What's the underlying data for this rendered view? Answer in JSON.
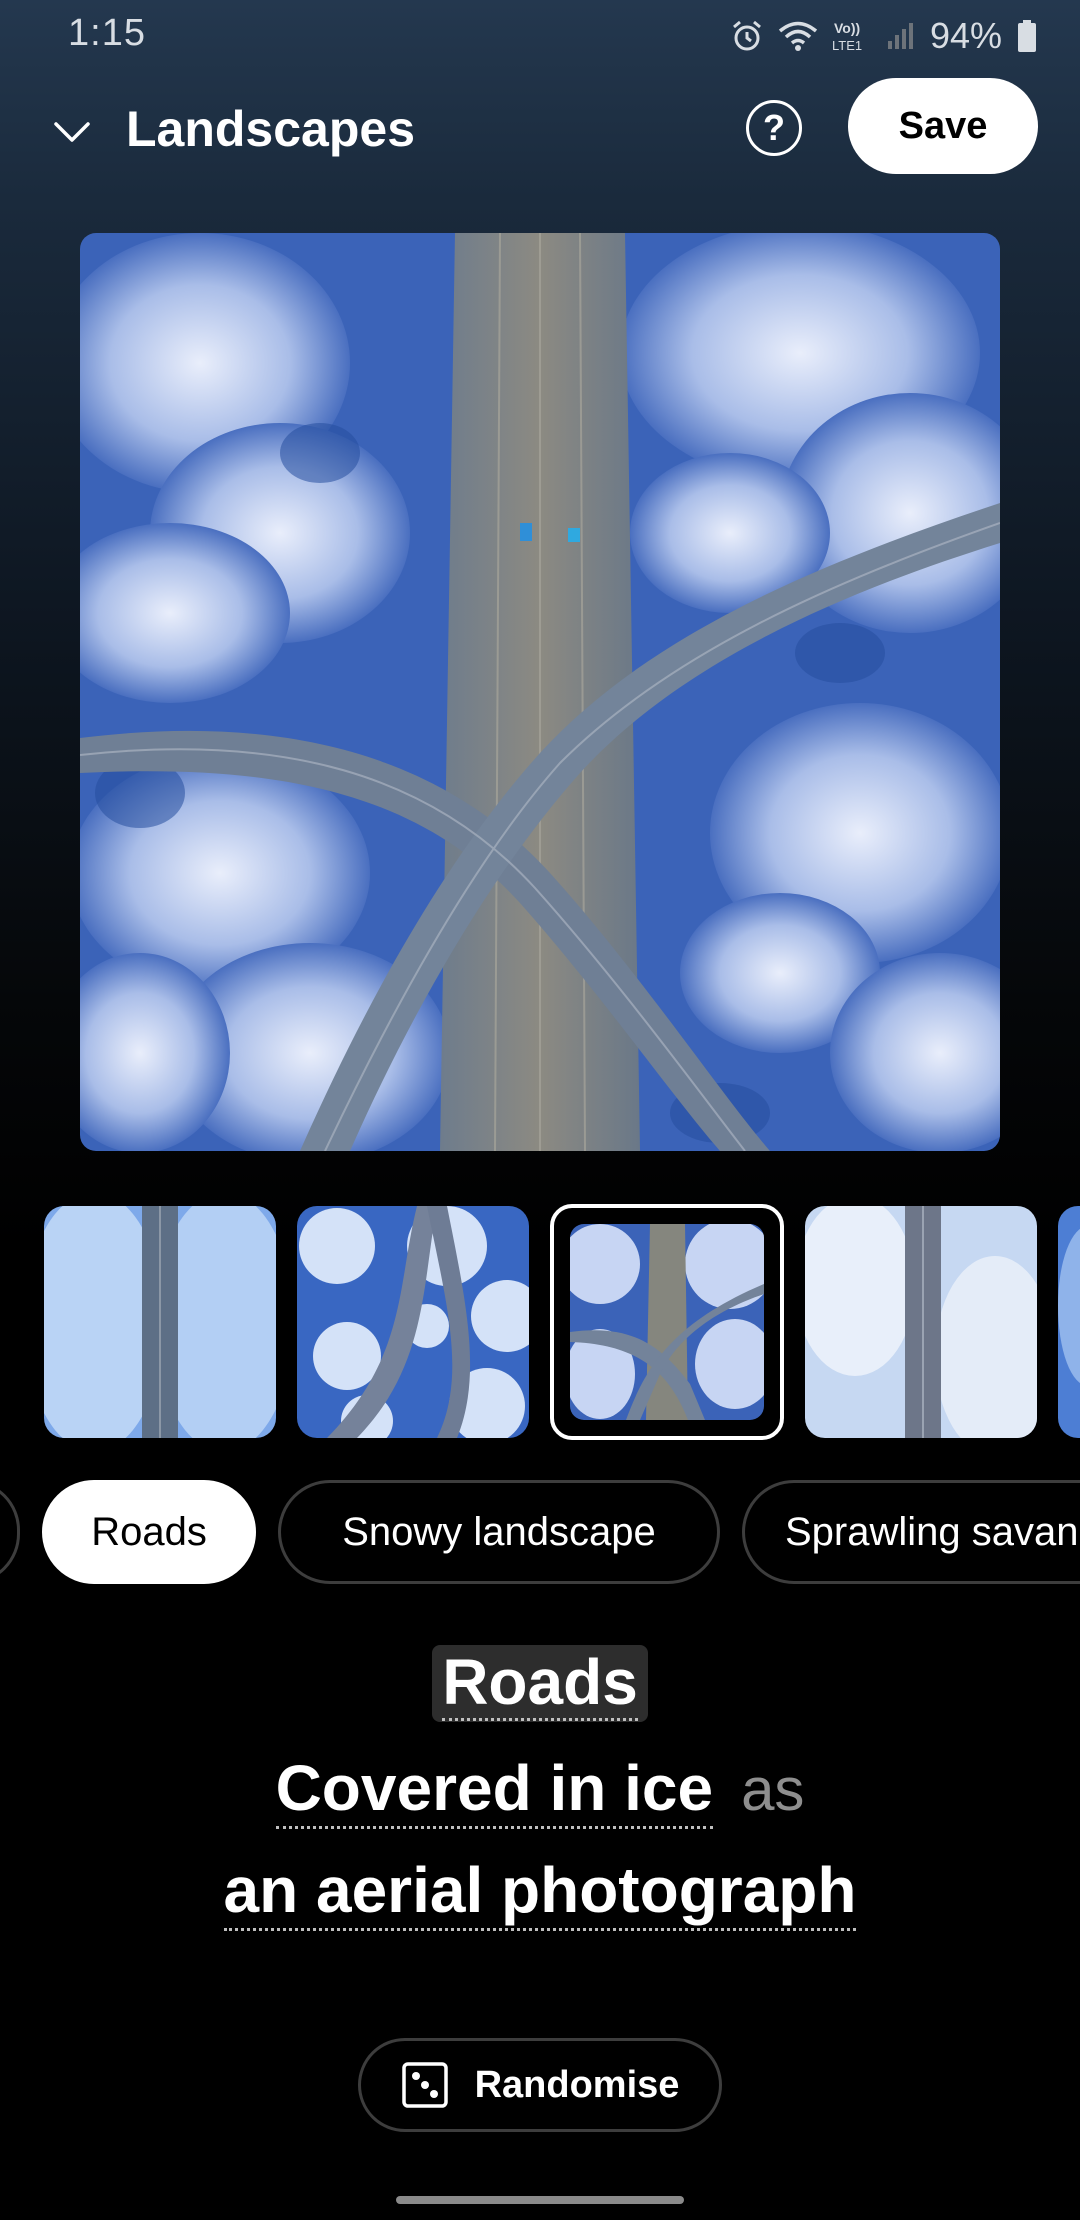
{
  "status_bar": {
    "time": "1:15",
    "battery_percent": "94%",
    "icons": [
      "alarm-icon",
      "wifi-icon",
      "volte-icon",
      "signal-icon",
      "battery-icon"
    ],
    "volte_label_top": "Vo))",
    "volte_label_bottom": "LTE1"
  },
  "header": {
    "title": "Landscapes",
    "help_label": "?",
    "save_label": "Save"
  },
  "thumbnails": {
    "count_visible": 5,
    "selected_index": 2
  },
  "chips": {
    "items": [
      "Roads",
      "Snowy landscape",
      "Sprawling savanna"
    ],
    "active": "Roads"
  },
  "prompt": {
    "subject": "Roads",
    "modifier": "Covered in ice",
    "connector": "as",
    "style": "an aerial photograph"
  },
  "randomise": {
    "label": "Randomise",
    "icon": "dice-icon"
  },
  "colors": {
    "background": "#000000",
    "accent": "#ffffff",
    "chip_border": "#3d3d3d"
  }
}
